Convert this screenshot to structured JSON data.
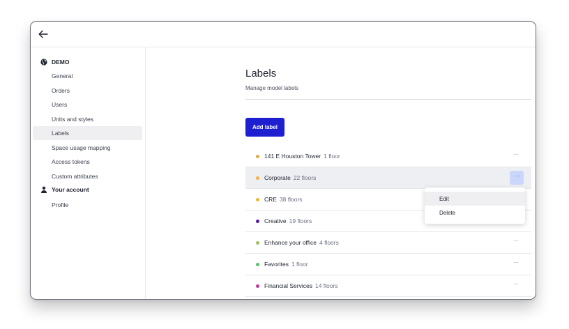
{
  "org": {
    "name": "DEMO",
    "icon": "globe-icon"
  },
  "sidebar": {
    "org_items": [
      {
        "label": "General"
      },
      {
        "label": "Orders"
      },
      {
        "label": "Users"
      },
      {
        "label": "Units and styles"
      },
      {
        "label": "Labels",
        "active": true
      },
      {
        "label": "Space usage mapping"
      },
      {
        "label": "Access tokens"
      },
      {
        "label": "Custom attributes"
      }
    ],
    "account_title": "Your account",
    "account_icon": "person-icon",
    "account_items": [
      {
        "label": "Profile"
      }
    ]
  },
  "page": {
    "title": "Labels",
    "subtitle": "Manage model labels",
    "add_label_button": "Add label"
  },
  "labels": [
    {
      "name": "141 E Houston Tower",
      "floors": "1 floor",
      "color": "#e0a84a",
      "more": "···"
    },
    {
      "name": "Corporate",
      "floors": "22 floors",
      "color": "#f2b33c",
      "more": "···",
      "hover": true
    },
    {
      "name": "CRE",
      "floors": "38 floors",
      "color": "#f1b52e",
      "more": "···"
    },
    {
      "name": "Creative",
      "floors": "19 floors",
      "color": "#5a1a9a",
      "more": "···"
    },
    {
      "name": "Enhance your office",
      "floors": "4 floors",
      "color": "#9cc068",
      "more": "···"
    },
    {
      "name": "Favorites",
      "floors": "1 floor",
      "color": "#5bbf6e",
      "more": "···"
    },
    {
      "name": "Financial Services",
      "floors": "14 floors",
      "color": "#c0389a",
      "more": "···"
    }
  ],
  "context_menu": {
    "items": [
      {
        "label": "Edit"
      },
      {
        "label": "Delete"
      }
    ]
  }
}
